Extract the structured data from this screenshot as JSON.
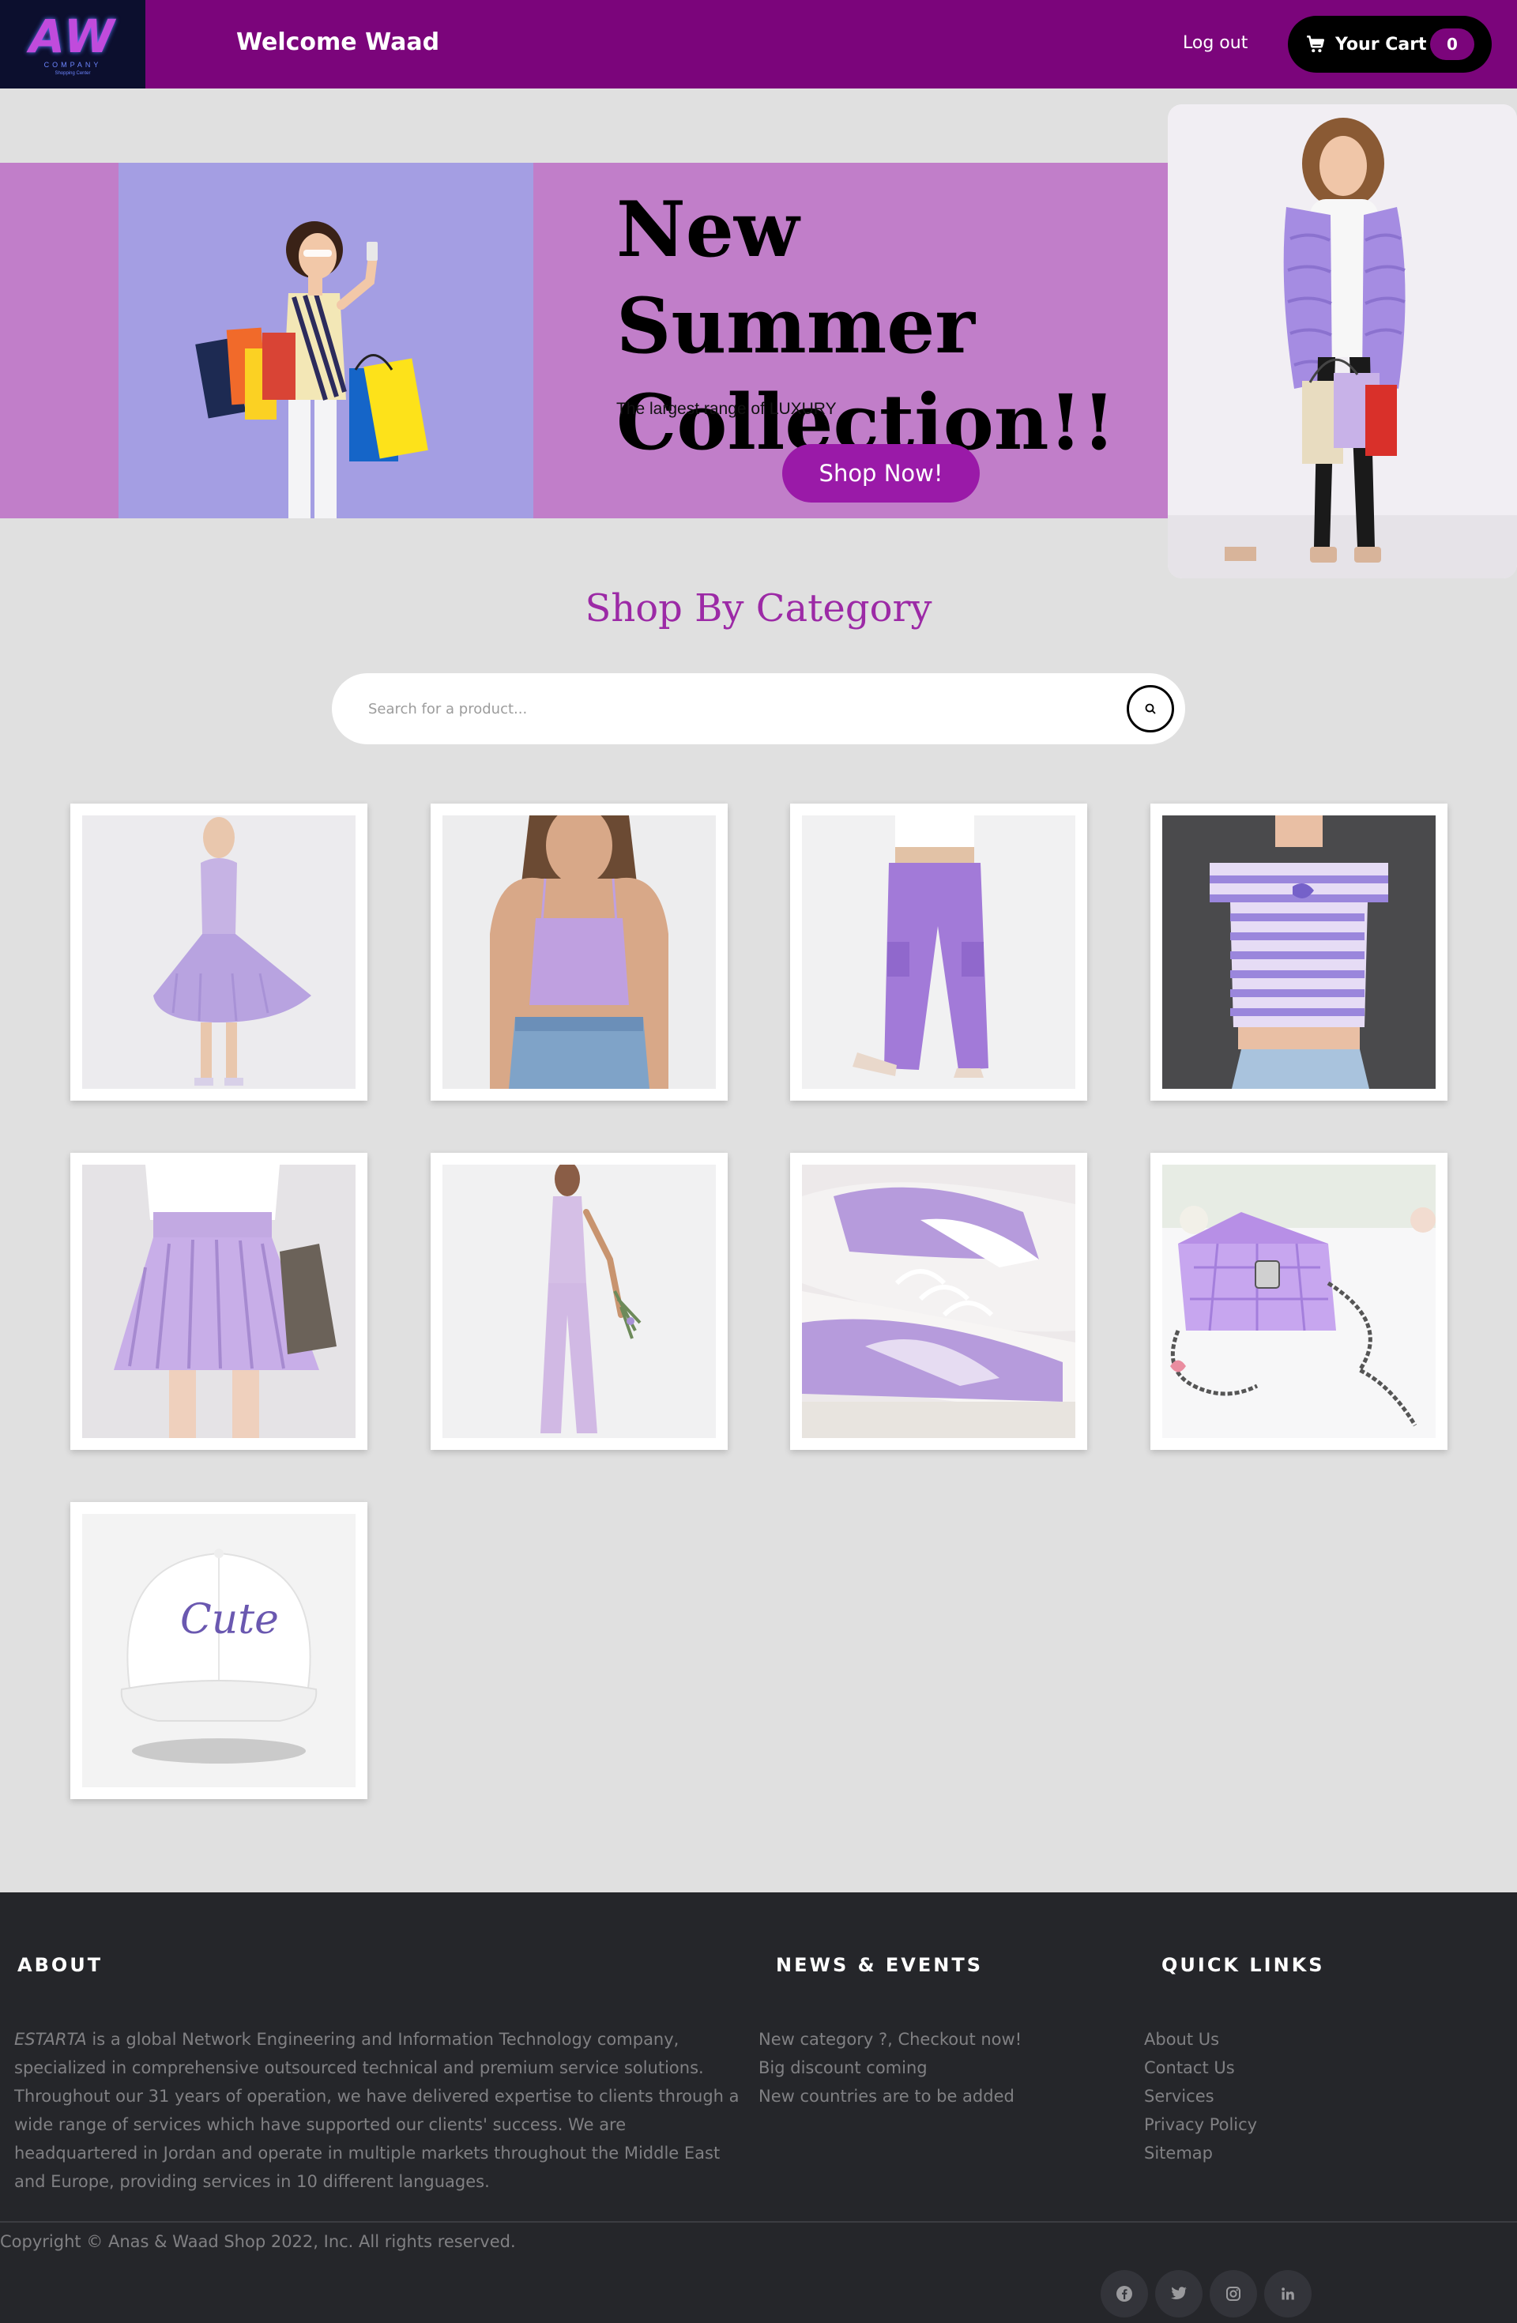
{
  "header": {
    "logo_text": "AW",
    "logo_subtext": "COMPANY",
    "logo_tagline": "Shopping Center",
    "welcome": "Welcome Waad",
    "logout_label": "Log out",
    "cart_label": "Your Cart",
    "cart_count": "0",
    "cart_icon": "cart-icon"
  },
  "hero": {
    "headline": "New Summer Collection!!",
    "subline": "The largest range of LUXURY",
    "cta_label": "Shop Now!",
    "image_left": "woman-with-shopping-bags-photo",
    "image_right": "woman-in-lavender-fur-vest-photo"
  },
  "category": {
    "title": "Shop By Category",
    "search_placeholder": "Search for a product...",
    "search_icon": "search-icon",
    "products": [
      {
        "name": "lavender-dress"
      },
      {
        "name": "lavender-crop-top"
      },
      {
        "name": "lavender-cargo-pants"
      },
      {
        "name": "striped-lavender-tee"
      },
      {
        "name": "pleated-lavender-skirt"
      },
      {
        "name": "lavender-jumpsuit"
      },
      {
        "name": "lavender-sneakers"
      },
      {
        "name": "lavender-quilted-bag"
      },
      {
        "name": "white-cute-cap",
        "print_text": "Cute"
      }
    ]
  },
  "footer": {
    "about_heading": "ABOUT",
    "about_brand": "ESTARTA",
    "about_text": " is a global Network Engineering and Information Technology company, specialized in comprehensive outsourced technical and premium service solutions. Throughout our 31 years of operation, we have delivered expertise to clients through a wide range of services which have supported our clients' success. We are headquartered in Jordan and operate in multiple markets throughout the Middle East and Europe, providing services in 10 different languages.",
    "news_heading": "NEWS & EVENTS",
    "news_items": [
      "New category ?, Checkout now!",
      "Big discount coming",
      "New countries are to be added"
    ],
    "links_heading": "QUICK LINKS",
    "links": [
      "About Us",
      "Contact Us",
      "Services",
      "Privacy Policy",
      "Sitemap"
    ],
    "copyright": "Copyright © Anas & Waad Shop 2022, Inc. All rights reserved.",
    "social": [
      "facebook-icon",
      "twitter-icon",
      "instagram-icon",
      "linkedin-icon"
    ]
  },
  "colors": {
    "header_bg": "#7b057b",
    "banner_bg": "#c17ec9",
    "accent": "#9a1aa8",
    "page_bg": "#e0e0e0",
    "footer_bg": "#25262a"
  }
}
